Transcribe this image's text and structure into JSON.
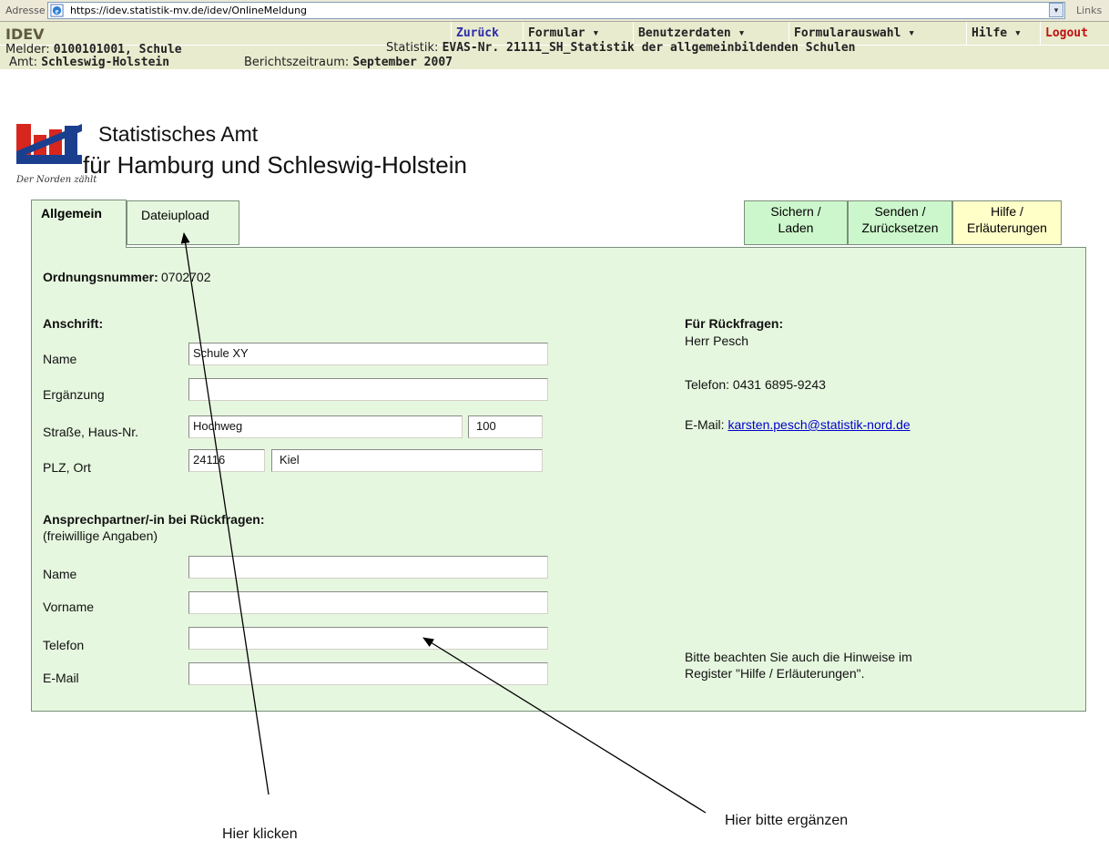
{
  "browser": {
    "address_label": "Adresse",
    "url": "https://idev.statistik-mv.de/idev/OnlineMeldung",
    "links_label": "Links",
    "dropdown_glyph": "▾"
  },
  "idev": {
    "title": "IDEV",
    "menu": {
      "back": "Zurück",
      "formular": "Formular ▾",
      "benutzerdaten": "Benutzerdaten ▾",
      "formularauswahl": "Formularauswahl ▾",
      "hilfe": "Hilfe ▾",
      "logout": "Logout"
    },
    "info": {
      "melder_label": "Melder:",
      "melder_value": "0100101001, Schule",
      "statistik_label": "Statistik:",
      "statistik_value": "EVAS-Nr. 21111_SH_Statistik der allgemeinbildenden Schulen",
      "amt_label": "Amt:",
      "amt_value": "Schleswig-Holstein",
      "zeitraum_label": "Berichtszeitraum:",
      "zeitraum_value": "September 2007"
    }
  },
  "logo": {
    "line1": "Statistisches Amt",
    "line2": "für Hamburg und Schleswig-Holstein",
    "slogan": "Der Norden zählt"
  },
  "tabs": {
    "allgemein": "Allgemein",
    "dateiupload": "Dateiupload",
    "sichern_1": "Sichern /",
    "sichern_2": "Laden",
    "senden_1": "Senden /",
    "senden_2": "Zurücksetzen",
    "hilfe_1": "Hilfe /",
    "hilfe_2": "Erläuterungen"
  },
  "form": {
    "ordnungsnummer_label": "Ordnungsnummer:",
    "ordnungsnummer_value": "0702702",
    "anschrift_label": "Anschrift:",
    "name_label": "Name",
    "name_value": "Schule XY",
    "ergaenzung_label": "Ergänzung",
    "ergaenzung_value": "",
    "strasse_label": "Straße, Haus-Nr.",
    "strasse_value": "Hochweg",
    "hausnr_value": "100",
    "plz_label": "PLZ, Ort",
    "plz_value": "24116",
    "ort_value": "Kiel",
    "contact_heading": "Ansprechpartner/-in bei Rückfragen:",
    "contact_sub": "(freiwillige Angaben)",
    "c_name_label": "Name",
    "c_vorname_label": "Vorname",
    "c_telefon_label": "Telefon",
    "c_email_label": "E-Mail"
  },
  "rueckfragen": {
    "heading": "Für Rückfragen:",
    "person": "Herr Pesch",
    "telefon": "Telefon: 0431 6895-9243",
    "email_label": "E-Mail:",
    "email": "karsten.pesch@statistik-nord.de",
    "hinweis_1": "Bitte beachten Sie auch die Hinweise im",
    "hinweis_2": "Register \"Hilfe / Erläuterungen\"."
  },
  "annotations": {
    "click_here": "Hier klicken",
    "fill_here": "Hier bitte ergänzen"
  }
}
